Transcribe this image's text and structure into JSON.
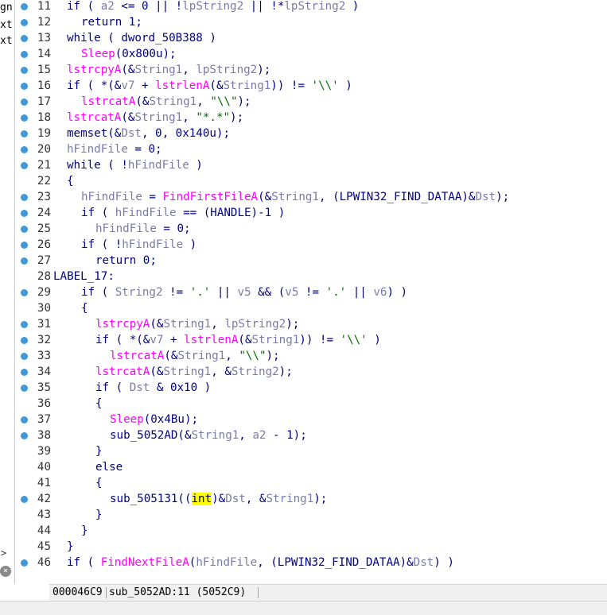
{
  "left_panel": {
    "fragments": [
      "gn",
      "xt",
      "xt"
    ],
    "chevron": ">",
    "close": "×"
  },
  "code_lines": [
    {
      "num": "11",
      "dot": true,
      "indent": 1,
      "tokens": [
        [
          "plain",
          "if ( "
        ],
        [
          "var",
          "a2"
        ],
        [
          "plain",
          " <= 0 || !"
        ],
        [
          "var",
          "lpString2"
        ],
        [
          "plain",
          " || !*"
        ],
        [
          "var",
          "lpString2"
        ],
        [
          "plain",
          " )"
        ]
      ]
    },
    {
      "num": "12",
      "dot": true,
      "indent": 2,
      "tokens": [
        [
          "plain",
          "return 1;"
        ]
      ]
    },
    {
      "num": "13",
      "dot": true,
      "indent": 1,
      "tokens": [
        [
          "plain",
          "while ( dword_50B388 )"
        ]
      ]
    },
    {
      "num": "14",
      "dot": true,
      "indent": 2,
      "tokens": [
        [
          "fn",
          "Sleep"
        ],
        [
          "plain",
          "(0x800u);"
        ]
      ]
    },
    {
      "num": "15",
      "dot": true,
      "indent": 1,
      "tokens": [
        [
          "fn",
          "lstrcpyA"
        ],
        [
          "plain",
          "(&"
        ],
        [
          "var",
          "String1"
        ],
        [
          "plain",
          ", "
        ],
        [
          "var",
          "lpString2"
        ],
        [
          "plain",
          ");"
        ]
      ]
    },
    {
      "num": "16",
      "dot": true,
      "indent": 1,
      "tokens": [
        [
          "plain",
          "if ( *(&"
        ],
        [
          "var",
          "v7"
        ],
        [
          "plain",
          " + "
        ],
        [
          "fn",
          "lstrlenA"
        ],
        [
          "plain",
          "(&"
        ],
        [
          "var",
          "String1"
        ],
        [
          "plain",
          ")) != "
        ],
        [
          "str",
          "'\\\\'"
        ],
        [
          "plain",
          " )"
        ]
      ]
    },
    {
      "num": "17",
      "dot": true,
      "indent": 2,
      "tokens": [
        [
          "fn",
          "lstrcatA"
        ],
        [
          "plain",
          "(&"
        ],
        [
          "var",
          "String1"
        ],
        [
          "plain",
          ", "
        ],
        [
          "str",
          "\"\\\\\""
        ],
        [
          "plain",
          ");"
        ]
      ]
    },
    {
      "num": "18",
      "dot": true,
      "indent": 1,
      "tokens": [
        [
          "fn",
          "lstrcatA"
        ],
        [
          "plain",
          "(&"
        ],
        [
          "var",
          "String1"
        ],
        [
          "plain",
          ", "
        ],
        [
          "str",
          "\"*.*\""
        ],
        [
          "plain",
          ");"
        ]
      ]
    },
    {
      "num": "19",
      "dot": true,
      "indent": 1,
      "tokens": [
        [
          "plain",
          "memset(&"
        ],
        [
          "var",
          "Dst"
        ],
        [
          "plain",
          ", 0, 0x140u);"
        ]
      ]
    },
    {
      "num": "20",
      "dot": true,
      "indent": 1,
      "tokens": [
        [
          "var",
          "hFindFile"
        ],
        [
          "plain",
          " = 0;"
        ]
      ]
    },
    {
      "num": "21",
      "dot": true,
      "indent": 1,
      "tokens": [
        [
          "plain",
          "while ( !"
        ],
        [
          "var",
          "hFindFile"
        ],
        [
          "plain",
          " )"
        ]
      ]
    },
    {
      "num": "22",
      "dot": false,
      "indent": 1,
      "tokens": [
        [
          "plain",
          "{"
        ]
      ]
    },
    {
      "num": "23",
      "dot": true,
      "indent": 2,
      "tokens": [
        [
          "var",
          "hFindFile"
        ],
        [
          "plain",
          " = "
        ],
        [
          "fn",
          "FindFirstFileA"
        ],
        [
          "plain",
          "(&"
        ],
        [
          "var",
          "String1"
        ],
        [
          "plain",
          ", (LPWIN32_FIND_DATAA)&"
        ],
        [
          "var",
          "Dst"
        ],
        [
          "plain",
          ");"
        ]
      ]
    },
    {
      "num": "24",
      "dot": true,
      "indent": 2,
      "tokens": [
        [
          "plain",
          "if ( "
        ],
        [
          "var",
          "hFindFile"
        ],
        [
          "plain",
          " == (HANDLE)-1 )"
        ]
      ]
    },
    {
      "num": "25",
      "dot": true,
      "indent": 3,
      "tokens": [
        [
          "var",
          "hFindFile"
        ],
        [
          "plain",
          " = 0;"
        ]
      ]
    },
    {
      "num": "26",
      "dot": true,
      "indent": 2,
      "tokens": [
        [
          "plain",
          "if ( !"
        ],
        [
          "var",
          "hFindFile"
        ],
        [
          "plain",
          " )"
        ]
      ]
    },
    {
      "num": "27",
      "dot": true,
      "indent": 3,
      "tokens": [
        [
          "plain",
          "return 0;"
        ]
      ]
    },
    {
      "num": "28",
      "dot": false,
      "indent": 0,
      "tokens": [
        [
          "plain",
          "LABEL_17:"
        ]
      ]
    },
    {
      "num": "29",
      "dot": true,
      "indent": 2,
      "tokens": [
        [
          "plain",
          "if ( "
        ],
        [
          "var",
          "String2"
        ],
        [
          "plain",
          " != "
        ],
        [
          "str",
          "'.'"
        ],
        [
          "plain",
          " || "
        ],
        [
          "var",
          "v5"
        ],
        [
          "plain",
          " && ("
        ],
        [
          "var",
          "v5"
        ],
        [
          "plain",
          " != "
        ],
        [
          "str",
          "'.'"
        ],
        [
          "plain",
          " || "
        ],
        [
          "var",
          "v6"
        ],
        [
          "plain",
          ") )"
        ]
      ]
    },
    {
      "num": "30",
      "dot": false,
      "indent": 2,
      "tokens": [
        [
          "plain",
          "{"
        ]
      ]
    },
    {
      "num": "31",
      "dot": true,
      "indent": 3,
      "tokens": [
        [
          "fn",
          "lstrcpyA"
        ],
        [
          "plain",
          "(&"
        ],
        [
          "var",
          "String1"
        ],
        [
          "plain",
          ", "
        ],
        [
          "var",
          "lpString2"
        ],
        [
          "plain",
          ");"
        ]
      ]
    },
    {
      "num": "32",
      "dot": true,
      "indent": 3,
      "tokens": [
        [
          "plain",
          "if ( *(&"
        ],
        [
          "var",
          "v7"
        ],
        [
          "plain",
          " + "
        ],
        [
          "fn",
          "lstrlenA"
        ],
        [
          "plain",
          "(&"
        ],
        [
          "var",
          "String1"
        ],
        [
          "plain",
          ")) != "
        ],
        [
          "str",
          "'\\\\'"
        ],
        [
          "plain",
          " )"
        ]
      ]
    },
    {
      "num": "33",
      "dot": true,
      "indent": 4,
      "tokens": [
        [
          "fn",
          "lstrcatA"
        ],
        [
          "plain",
          "(&"
        ],
        [
          "var",
          "String1"
        ],
        [
          "plain",
          ", "
        ],
        [
          "str",
          "\"\\\\\""
        ],
        [
          "plain",
          ");"
        ]
      ]
    },
    {
      "num": "34",
      "dot": true,
      "indent": 3,
      "tokens": [
        [
          "fn",
          "lstrcatA"
        ],
        [
          "plain",
          "(&"
        ],
        [
          "var",
          "String1"
        ],
        [
          "plain",
          ", &"
        ],
        [
          "var",
          "String2"
        ],
        [
          "plain",
          ");"
        ]
      ]
    },
    {
      "num": "35",
      "dot": true,
      "indent": 3,
      "tokens": [
        [
          "plain",
          "if ( "
        ],
        [
          "var",
          "Dst"
        ],
        [
          "plain",
          " & 0x10 )"
        ]
      ]
    },
    {
      "num": "36",
      "dot": false,
      "indent": 3,
      "tokens": [
        [
          "plain",
          "{"
        ]
      ]
    },
    {
      "num": "37",
      "dot": true,
      "indent": 4,
      "tokens": [
        [
          "fn",
          "Sleep"
        ],
        [
          "plain",
          "(0x4Bu);"
        ]
      ]
    },
    {
      "num": "38",
      "dot": true,
      "indent": 4,
      "tokens": [
        [
          "plain",
          "sub_5052AD(&"
        ],
        [
          "var",
          "String1"
        ],
        [
          "plain",
          ", "
        ],
        [
          "var",
          "a2"
        ],
        [
          "plain",
          " - 1);"
        ]
      ]
    },
    {
      "num": "39",
      "dot": false,
      "indent": 3,
      "tokens": [
        [
          "plain",
          "}"
        ]
      ]
    },
    {
      "num": "40",
      "dot": false,
      "indent": 3,
      "tokens": [
        [
          "plain",
          "else"
        ]
      ]
    },
    {
      "num": "41",
      "dot": false,
      "indent": 3,
      "tokens": [
        [
          "plain",
          "{"
        ]
      ]
    },
    {
      "num": "42",
      "dot": true,
      "indent": 4,
      "tokens": [
        [
          "plain",
          "sub_505131(("
        ],
        [
          "hl",
          "int"
        ],
        [
          "plain",
          ")&"
        ],
        [
          "var",
          "Dst"
        ],
        [
          "plain",
          ", &"
        ],
        [
          "var",
          "String1"
        ],
        [
          "plain",
          ");"
        ]
      ]
    },
    {
      "num": "43",
      "dot": false,
      "indent": 3,
      "tokens": [
        [
          "plain",
          "}"
        ]
      ]
    },
    {
      "num": "44",
      "dot": false,
      "indent": 2,
      "tokens": [
        [
          "plain",
          "}"
        ]
      ]
    },
    {
      "num": "45",
      "dot": false,
      "indent": 1,
      "tokens": [
        [
          "plain",
          "}"
        ]
      ]
    },
    {
      "num": "46",
      "dot": true,
      "indent": 1,
      "tokens": [
        [
          "plain",
          "if ( "
        ],
        [
          "fn",
          "FindNextFileA"
        ],
        [
          "plain",
          "("
        ],
        [
          "var",
          "hFindFile"
        ],
        [
          "plain",
          ", (LPWIN32_FIND_DATAA)&"
        ],
        [
          "var",
          "Dst"
        ],
        [
          "plain",
          ") )"
        ]
      ]
    }
  ],
  "status": {
    "address": "000046C9",
    "location": "sub_5052AD:11 (5052C9)"
  },
  "colors": {
    "breakpoint_dot": "#3f98d8",
    "keyword": "#000080",
    "function": "#ff00ff",
    "variable": "#7a7aa8",
    "string": "#007000",
    "highlight": "#ffff00"
  }
}
